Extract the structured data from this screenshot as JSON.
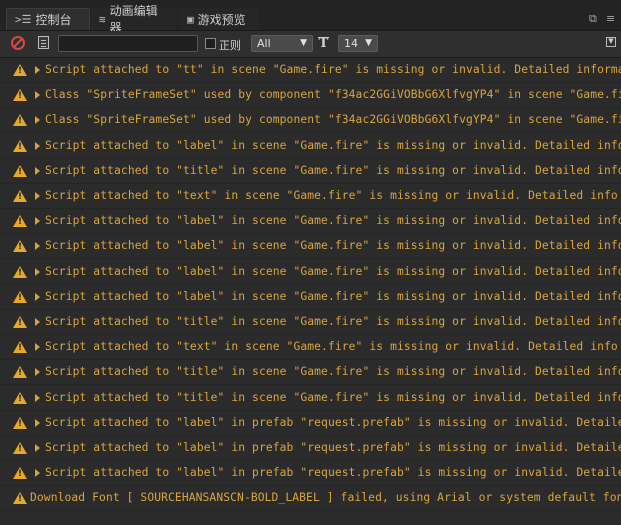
{
  "tabs": [
    {
      "label": "控制台",
      "icon": "terminal-icon",
      "active": true
    },
    {
      "label": "动画编辑器",
      "icon": "animation-icon",
      "active": false
    },
    {
      "label": "游戏预览",
      "icon": "preview-icon",
      "active": false
    }
  ],
  "toolbar": {
    "search_value": "",
    "regex_label": "正则",
    "level_select": "All",
    "font_size_select": "14"
  },
  "colors": {
    "warning": "#e8a729",
    "message": "#d9a63e",
    "clear": "#d9483b"
  },
  "logs": [
    {
      "text": "Script attached to \"tt\" in scene \"Game.fire\" is missing or invalid. Detailed information",
      "expandable": true
    },
    {
      "text": "Class \"SpriteFrameSet\" used by component \"f34ac2GGiVOBbG6XlfvgYP4\" in scene \"Game.fire\"",
      "expandable": true
    },
    {
      "text": "Class \"SpriteFrameSet\" used by component \"f34ac2GGiVOBbG6XlfvgYP4\" in scene \"Game.fire\"",
      "expandable": true
    },
    {
      "text": "Script attached to \"label\" in scene \"Game.fire\" is missing or invalid. Detailed info",
      "expandable": true
    },
    {
      "text": "Script attached to \"title\" in scene \"Game.fire\" is missing or invalid. Detailed info",
      "expandable": true
    },
    {
      "text": "Script attached to \"text\" in scene \"Game.fire\" is missing or invalid. Detailed info",
      "expandable": true
    },
    {
      "text": "Script attached to \"label\" in scene \"Game.fire\" is missing or invalid. Detailed info",
      "expandable": true
    },
    {
      "text": "Script attached to \"label\" in scene \"Game.fire\" is missing or invalid. Detailed info",
      "expandable": true
    },
    {
      "text": "Script attached to \"label\" in scene \"Game.fire\" is missing or invalid. Detailed info",
      "expandable": true
    },
    {
      "text": "Script attached to \"label\" in scene \"Game.fire\" is missing or invalid. Detailed info",
      "expandable": true
    },
    {
      "text": "Script attached to \"title\" in scene \"Game.fire\" is missing or invalid. Detailed info",
      "expandable": true
    },
    {
      "text": "Script attached to \"text\" in scene \"Game.fire\" is missing or invalid. Detailed info",
      "expandable": true
    },
    {
      "text": "Script attached to \"title\" in scene \"Game.fire\" is missing or invalid. Detailed info",
      "expandable": true
    },
    {
      "text": "Script attached to \"title\" in scene \"Game.fire\" is missing or invalid. Detailed info",
      "expandable": true
    },
    {
      "text": "Script attached to \"label\" in prefab \"request.prefab\" is missing or invalid. Detailed",
      "expandable": true
    },
    {
      "text": "Script attached to \"label\" in prefab \"request.prefab\" is missing or invalid. Detailed",
      "expandable": true
    },
    {
      "text": "Script attached to \"label\" in prefab \"request.prefab\" is missing or invalid. Detailed",
      "expandable": true
    },
    {
      "text": "Download Font [ SOURCEHANSANSCN-BOLD_LABEL ] failed, using Arial or system default font",
      "expandable": false
    }
  ]
}
